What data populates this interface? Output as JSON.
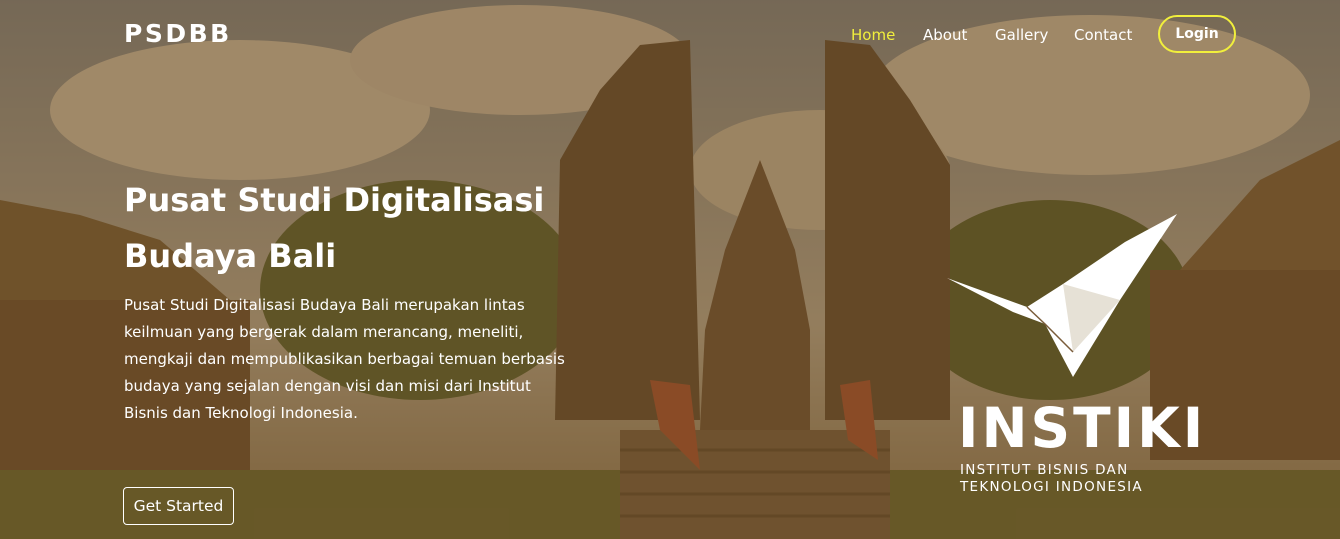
{
  "navbar": {
    "brand": "PSDBB",
    "links": [
      {
        "label": "Home",
        "active": true
      },
      {
        "label": "About",
        "active": false
      },
      {
        "label": "Gallery",
        "active": false
      },
      {
        "label": "Contact",
        "active": false
      }
    ],
    "login_label": "Login"
  },
  "hero": {
    "title": "Pusat Studi Digitalisasi Budaya Bali",
    "description": "Pusat Studi Digitalisasi Budaya Bali merupakan lintas keilmuan yang bergerak dalam merancang, meneliti, mengkaji dan mempublikasikan berbagai temuan berbasis budaya yang sejalan dengan visi dan misi dari Institut Bisnis dan Teknologi Indonesia.",
    "cta_label": "Get Started",
    "background": "temple-gate-photo"
  },
  "logo": {
    "icon": "bird-origami-icon",
    "wordmark": "INSTIKI",
    "subtitle_line1": "INSTITUT BISNIS DAN",
    "subtitle_line2": "TEKNOLOGI INDONESIA"
  },
  "colors": {
    "accent": "#f1ef3c",
    "overlay": "#735023",
    "text": "#ffffff"
  }
}
